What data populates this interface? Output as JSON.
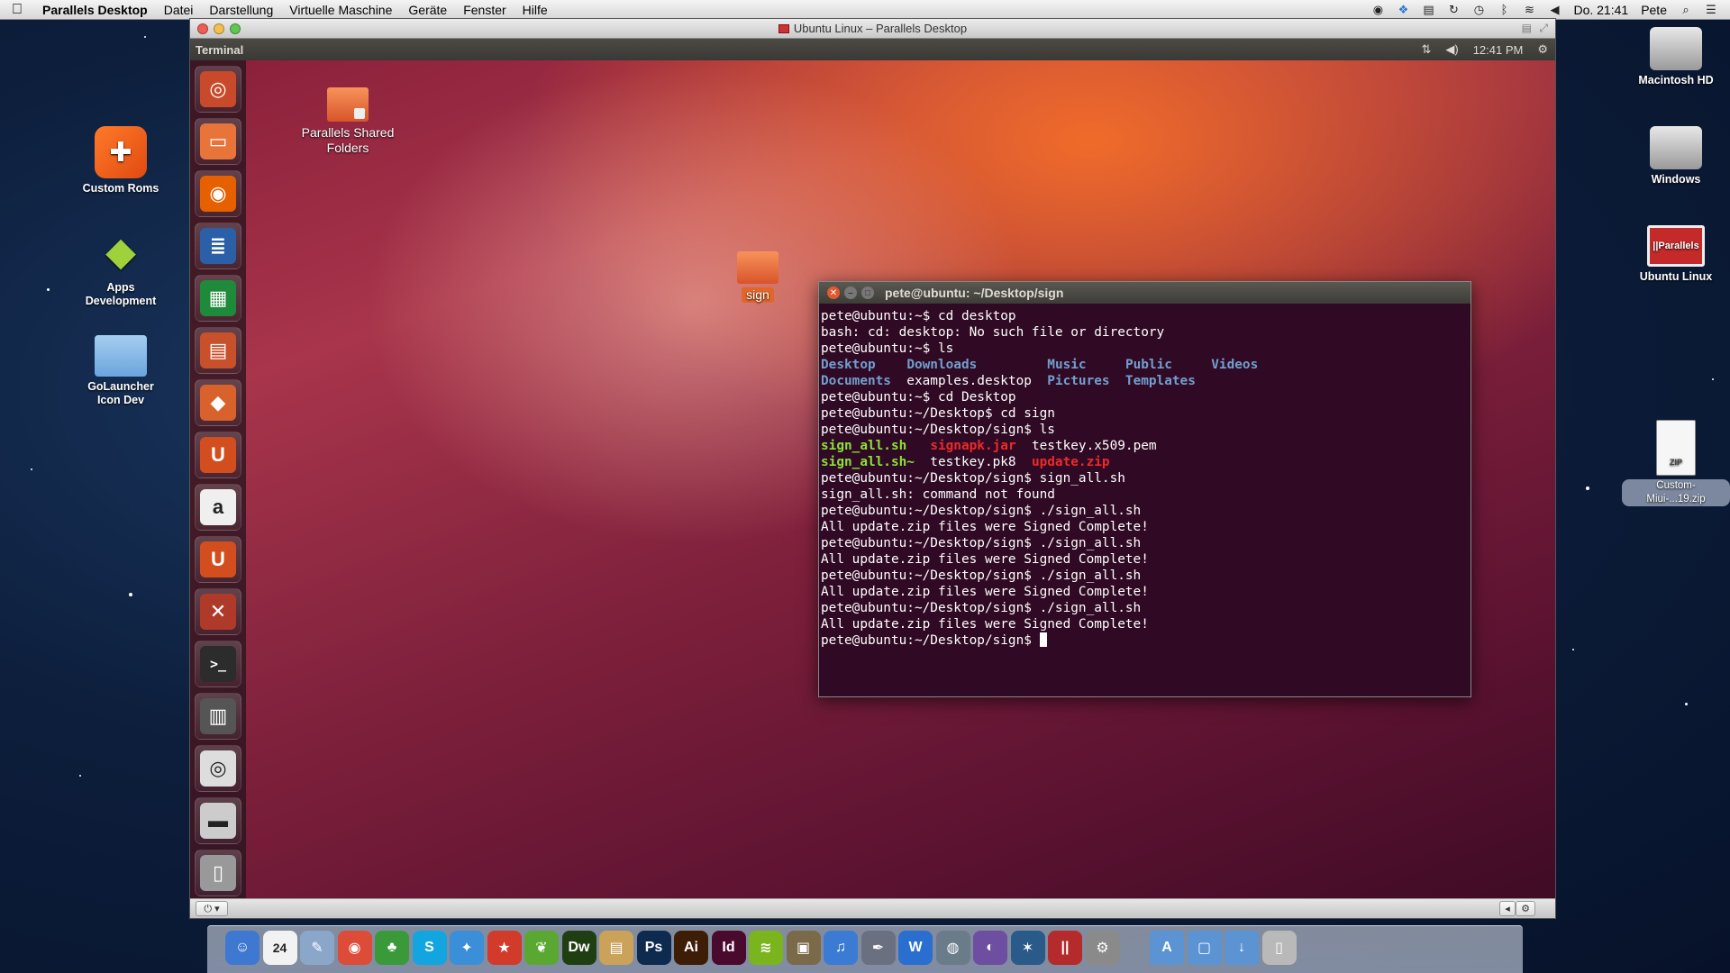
{
  "mac_menubar": {
    "app": "Parallels Desktop",
    "menus": [
      "Datei",
      "Darstellung",
      "Virtuelle Maschine",
      "Geräte",
      "Fenster",
      "Hilfe"
    ],
    "clock": "Do. 21:41",
    "user": "Pete"
  },
  "mac_desktop_icons_left": [
    {
      "label": "Custom Roms",
      "icon": "box-app-icon"
    },
    {
      "label": "Apps\nDevelopment",
      "icon": "android-icon"
    },
    {
      "label": "GoLauncher\nIcon Dev",
      "icon": "folder-icon"
    }
  ],
  "mac_desktop_icons_right": [
    {
      "label": "Macintosh HD",
      "icon": "hard-drive-icon"
    },
    {
      "label": "Windows",
      "icon": "hard-drive-icon"
    },
    {
      "label": "Ubuntu Linux",
      "icon": "parallels-vm-icon"
    },
    {
      "label": "Custom-\nMiui-...19.zip",
      "icon": "zip-file-icon"
    }
  ],
  "parallels_window": {
    "title": "Ubuntu Linux – Parallels Desktop"
  },
  "ubuntu_panel": {
    "app_name": "Terminal",
    "time": "12:41 PM"
  },
  "ubuntu_desktop_icons": [
    {
      "label": "Parallels Shared\nFolders",
      "icon": "shared-folder-icon"
    },
    {
      "label": "sign",
      "icon": "folder-icon"
    }
  ],
  "terminal": {
    "title": "pete@ubuntu: ~/Desktop/sign",
    "lines": [
      [
        {
          "t": "pete@ubuntu:~$ cd desktop",
          "c": ""
        }
      ],
      [
        {
          "t": "bash: cd: desktop: No such file or directory",
          "c": ""
        }
      ],
      [
        {
          "t": "pete@ubuntu:~$ ls",
          "c": ""
        }
      ],
      [
        {
          "t": "Desktop",
          "c": "blue"
        },
        {
          "t": "    ",
          "c": ""
        },
        {
          "t": "Downloads",
          "c": "blue"
        },
        {
          "t": "         ",
          "c": ""
        },
        {
          "t": "Music",
          "c": "blue"
        },
        {
          "t": "     ",
          "c": ""
        },
        {
          "t": "Public",
          "c": "blue"
        },
        {
          "t": "     ",
          "c": ""
        },
        {
          "t": "Videos",
          "c": "blue"
        }
      ],
      [
        {
          "t": "Documents",
          "c": "blue"
        },
        {
          "t": "  examples.desktop  ",
          "c": ""
        },
        {
          "t": "Pictures",
          "c": "blue"
        },
        {
          "t": "  ",
          "c": ""
        },
        {
          "t": "Templates",
          "c": "blue"
        }
      ],
      [
        {
          "t": "pete@ubuntu:~$ cd Desktop",
          "c": ""
        }
      ],
      [
        {
          "t": "pete@ubuntu:~/Desktop$ cd sign",
          "c": ""
        }
      ],
      [
        {
          "t": "pete@ubuntu:~/Desktop/sign$ ls",
          "c": ""
        }
      ],
      [
        {
          "t": "sign_all.sh",
          "c": "green"
        },
        {
          "t": "   ",
          "c": ""
        },
        {
          "t": "signapk.jar",
          "c": "red"
        },
        {
          "t": "  testkey.x509.pem",
          "c": ""
        }
      ],
      [
        {
          "t": "sign_all.sh~",
          "c": "green"
        },
        {
          "t": "  testkey.pk8  ",
          "c": ""
        },
        {
          "t": "update.zip",
          "c": "red"
        }
      ],
      [
        {
          "t": "pete@ubuntu:~/Desktop/sign$ sign_all.sh",
          "c": ""
        }
      ],
      [
        {
          "t": "sign_all.sh: command not found",
          "c": ""
        }
      ],
      [
        {
          "t": "pete@ubuntu:~/Desktop/sign$ ./sign_all.sh",
          "c": ""
        }
      ],
      [
        {
          "t": "All update.zip files were Signed Complete!",
          "c": ""
        }
      ],
      [
        {
          "t": "pete@ubuntu:~/Desktop/sign$ ./sign_all.sh",
          "c": ""
        }
      ],
      [
        {
          "t": "All update.zip files were Signed Complete!",
          "c": ""
        }
      ],
      [
        {
          "t": "pete@ubuntu:~/Desktop/sign$ ./sign_all.sh",
          "c": ""
        }
      ],
      [
        {
          "t": "All update.zip files were Signed Complete!",
          "c": ""
        }
      ],
      [
        {
          "t": "pete@ubuntu:~/Desktop/sign$ ./sign_all.sh",
          "c": ""
        }
      ],
      [
        {
          "t": "All update.zip files were Signed Complete!",
          "c": ""
        }
      ]
    ],
    "prompt": "pete@ubuntu:~/Desktop/sign$ "
  },
  "launcher_items": [
    {
      "name": "dash-home-icon",
      "glyph": "◎",
      "color": "#c94a2a"
    },
    {
      "name": "files-folder-icon",
      "glyph": "▭",
      "color": "#e8743a"
    },
    {
      "name": "firefox-icon",
      "glyph": "◉",
      "color": "#e66000"
    },
    {
      "name": "libreoffice-writer-icon",
      "glyph": "≣",
      "color": "#2b5fa8"
    },
    {
      "name": "libreoffice-calc-icon",
      "glyph": "▦",
      "color": "#1f8a3a"
    },
    {
      "name": "libreoffice-impress-icon",
      "glyph": "▤",
      "color": "#c8502a"
    },
    {
      "name": "software-center-icon",
      "glyph": "◆",
      "color": "#d9622c"
    },
    {
      "name": "ubuntu-one-icon",
      "glyph": "U",
      "color": "#d24e1e"
    },
    {
      "name": "amazon-icon",
      "glyph": "a",
      "color": "#efefef"
    },
    {
      "name": "ubuntu-one-music-icon",
      "glyph": "U",
      "color": "#d24e1e"
    },
    {
      "name": "system-settings-icon",
      "glyph": "✕",
      "color": "#b03a2a"
    },
    {
      "name": "terminal-icon",
      "glyph": ">_",
      "color": "#2c2c2c"
    },
    {
      "name": "workspace-switcher-icon",
      "glyph": "▥",
      "color": "#555"
    },
    {
      "name": "dvd-drive-icon",
      "glyph": "◎",
      "color": "#ddd"
    },
    {
      "name": "removable-drive-icon",
      "glyph": "▬",
      "color": "#ccc"
    },
    {
      "name": "trash-icon",
      "glyph": "▯",
      "color": "#999"
    }
  ],
  "dock_items": [
    {
      "name": "finder-icon",
      "glyph": "☺",
      "color": "#3f78d0"
    },
    {
      "name": "calendar-icon",
      "glyph": "24",
      "color": "#f2f2f2"
    },
    {
      "name": "preview-icon",
      "glyph": "✎",
      "color": "#8aa6c9"
    },
    {
      "name": "chrome-icon",
      "glyph": "◉",
      "color": "#dd4b39"
    },
    {
      "name": "adium-icon",
      "glyph": "♣",
      "color": "#3a9a3a"
    },
    {
      "name": "skype-icon",
      "glyph": "S",
      "color": "#12a5e0"
    },
    {
      "name": "twitter-icon",
      "glyph": "✦",
      "color": "#3a8fd8"
    },
    {
      "name": "fantastical-icon",
      "glyph": "★",
      "color": "#d23a2a"
    },
    {
      "name": "coda-icon",
      "glyph": "❦",
      "color": "#5aa832"
    },
    {
      "name": "dreamweaver-icon",
      "glyph": "Dw",
      "color": "#1f3f12"
    },
    {
      "name": "transmit-icon",
      "glyph": "▤",
      "color": "#caa25a"
    },
    {
      "name": "photoshop-icon",
      "glyph": "Ps",
      "color": "#0e2b4f"
    },
    {
      "name": "illustrator-icon",
      "glyph": "Ai",
      "color": "#3e1d07"
    },
    {
      "name": "indesign-icon",
      "glyph": "Id",
      "color": "#4a0a2e"
    },
    {
      "name": "spotify-icon",
      "glyph": "≋",
      "color": "#7ab51d"
    },
    {
      "name": "iphoto-icon",
      "glyph": "▣",
      "color": "#7a6a4a"
    },
    {
      "name": "itunes-icon",
      "glyph": "♫",
      "color": "#3b7bd4"
    },
    {
      "name": "script-editor-icon",
      "glyph": "✒",
      "color": "#6a7080"
    },
    {
      "name": "word-icon",
      "glyph": "W",
      "color": "#2a6ed0"
    },
    {
      "name": "network-utility-icon",
      "glyph": "◍",
      "color": "#6a7c8a"
    },
    {
      "name": "eclipse-icon",
      "glyph": "◐",
      "color": "#6d4ea0"
    },
    {
      "name": "netbeans-icon",
      "glyph": "✶",
      "color": "#2a5a8a"
    },
    {
      "name": "parallels-icon",
      "glyph": "||",
      "color": "#b52a2a"
    },
    {
      "name": "system-preferences-icon",
      "glyph": "⚙",
      "color": "#8a8a8a"
    },
    {
      "name": "applications-folder-icon",
      "glyph": "A",
      "color": "#5b93d3"
    },
    {
      "name": "documents-folder-icon",
      "glyph": "▢",
      "color": "#5b93d3"
    },
    {
      "name": "downloads-folder-icon",
      "glyph": "↓",
      "color": "#5b93d3"
    },
    {
      "name": "trash-icon",
      "glyph": "▯",
      "color": "#b9b9b9"
    }
  ]
}
